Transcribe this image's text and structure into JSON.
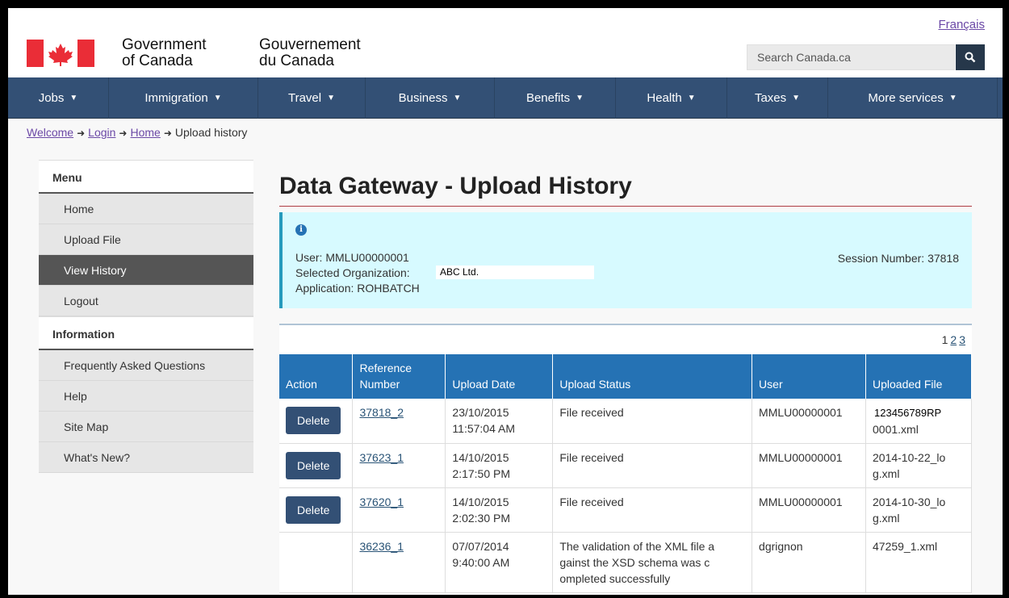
{
  "header": {
    "signature_en_line1": "Government",
    "signature_en_line2": "of Canada",
    "signature_fr_line1": "Gouvernement",
    "signature_fr_line2": "du Canada",
    "language_link": "Français",
    "search_placeholder": "Search Canada.ca",
    "search_icon": "search-icon",
    "flag_icon": "canada-flag-icon"
  },
  "nav": {
    "items": [
      {
        "label": "Jobs"
      },
      {
        "label": "Immigration"
      },
      {
        "label": "Travel"
      },
      {
        "label": "Business"
      },
      {
        "label": "Benefits"
      },
      {
        "label": "Health"
      },
      {
        "label": "Taxes"
      },
      {
        "label": "More services"
      }
    ]
  },
  "breadcrumb": {
    "items": [
      "Welcome",
      "Login",
      "Home"
    ],
    "current": "Upload history"
  },
  "sidebar": {
    "menu_heading": "Menu",
    "menu_items": [
      {
        "label": "Home"
      },
      {
        "label": "Upload File"
      },
      {
        "label": "View History"
      },
      {
        "label": "Logout"
      }
    ],
    "info_heading": "Information",
    "info_items": [
      {
        "label": "Frequently Asked Questions"
      },
      {
        "label": "Help"
      },
      {
        "label": "Site Map"
      },
      {
        "label": "What's New?"
      }
    ]
  },
  "main": {
    "title": "Data Gateway - Upload History",
    "info": {
      "user": "User: MMLU00000001",
      "org_label": "Selected Organization:",
      "org_value": "ABC Ltd.",
      "application": "Application: ROHBATCH",
      "session": "Session Number: 37818"
    },
    "pager": {
      "current": "1",
      "pages": [
        "2",
        "3"
      ]
    },
    "table": {
      "headers": [
        "Action",
        "Reference Number",
        "Upload Date",
        "Upload Status",
        "User",
        "Uploaded File"
      ],
      "delete_label": "Delete",
      "rows": [
        {
          "ref": "37818_2",
          "date": "23/10/2015 11:57:04 AM",
          "status": "File received",
          "user": "MMLU00000001",
          "file": "123456789RP",
          "file2": "0001.xml"
        },
        {
          "ref": "37623_1",
          "date": "14/10/2015 2:17:50 PM",
          "status": "File received",
          "user": "MMLU00000001",
          "file": "2014-10-22_lo g.xml"
        },
        {
          "ref": "37620_1",
          "date": "14/10/2015 2:02:30 PM",
          "status": "File received",
          "user": "MMLU00000001",
          "file": "2014-10-30_lo g.xml"
        },
        {
          "ref": "36236_1",
          "date": "07/07/2014 9:40:00 AM",
          "status": "The validation of the XML file a gainst the XSD schema was c ompleted successfully",
          "user": "dgrignon",
          "file": "47259_1.xml"
        }
      ]
    }
  },
  "colors": {
    "nav_bg": "#335075",
    "table_header_bg": "#2572b4",
    "info_panel_bg": "#d7faff",
    "flag_red": "#ea2d37"
  }
}
